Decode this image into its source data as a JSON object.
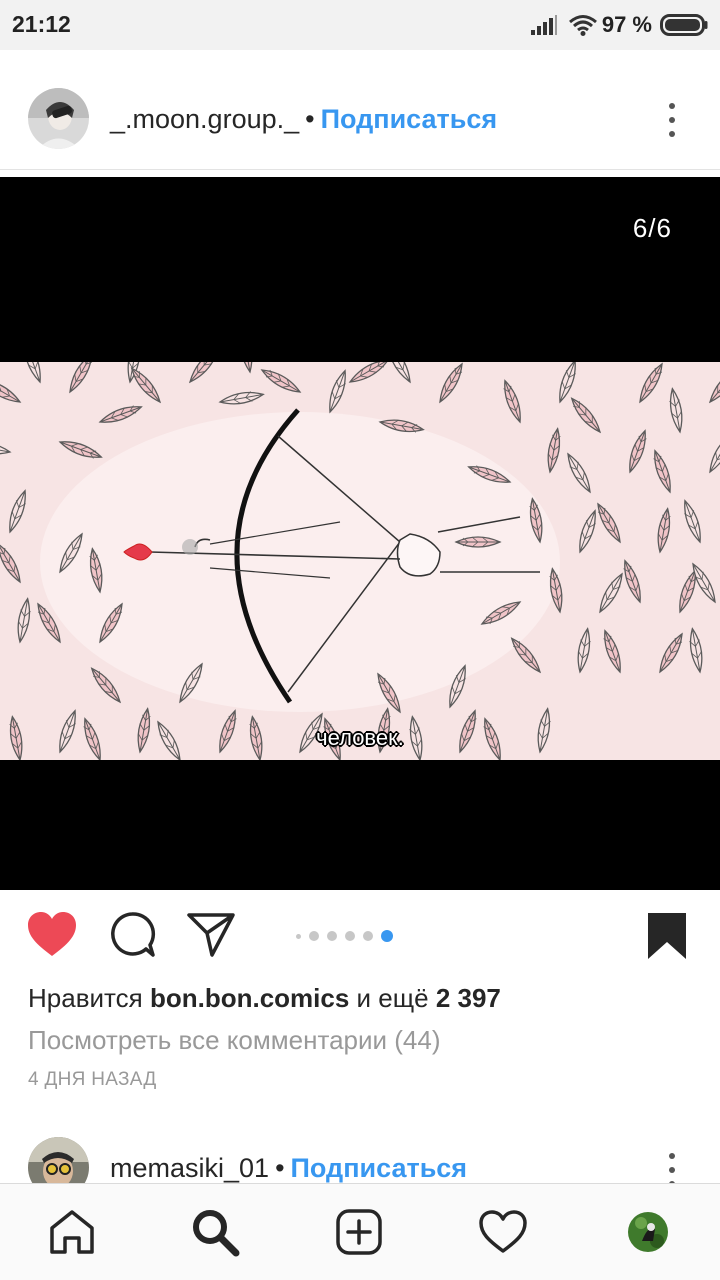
{
  "status_bar": {
    "time": "21:12",
    "battery_percent": "97 %",
    "icons": [
      "signal-icon",
      "wifi-icon",
      "battery-icon"
    ]
  },
  "post": {
    "username": "_.moon.group._",
    "separator": "•",
    "follow_label": "Подписаться",
    "slide_counter": "6/6",
    "caption_overlay": "человек.",
    "carousel": {
      "total": 6,
      "active_index": 5
    },
    "likes": {
      "prefix": "Нравится ",
      "liked_by": "bon.bon.comics",
      "middle": " и ещё ",
      "others_count": "2 397"
    },
    "view_comments": "Посмотреть все комментарии (44)",
    "timestamp": "4 ДНЯ НАЗАД",
    "liked": true,
    "saved": true
  },
  "next_post": {
    "username": "memasiki_01",
    "separator": "•",
    "follow_label": "Подписаться"
  },
  "bottom_nav": {
    "items": [
      "home-icon",
      "search-icon",
      "new-post-icon",
      "activity-icon",
      "profile-avatar"
    ]
  },
  "colors": {
    "accent": "#3897f0",
    "like_red": "#ed4956",
    "text": "#262626",
    "muted": "#999999"
  }
}
